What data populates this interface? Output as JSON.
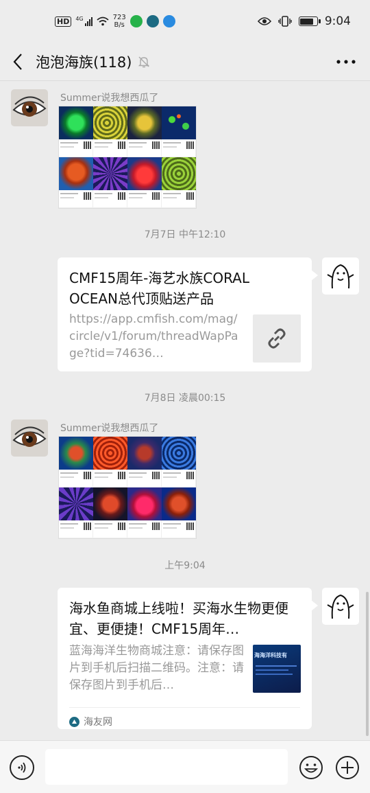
{
  "status_bar": {
    "hd": "HD",
    "net_type": "4G",
    "speed_value": "723",
    "speed_unit": "B/s",
    "time": "9:04",
    "battery_level": 0.8
  },
  "header": {
    "title": "泡泡海族(118)"
  },
  "messages": {
    "m1_sender": "Summer说我想西瓜了",
    "t1": "7月7日 中午12:10",
    "link_title": "CMF15周年-海艺水族CORAL OCEAN总代顶贴送产品",
    "link_url": "https://app.cmfish.com/mag/circle/v1/forum/threadWapPage?tid=74636…",
    "t2": "7月8日 凌晨00:15",
    "m2_sender": "Summer说我想西瓜了",
    "t3": "上午9:04",
    "article_title": "海水鱼商城上线啦！买海水生物更便宜、更便捷！CMF15周年…",
    "article_desc": "蓝海海洋生物商城注意：请保存图片到手机后扫描二维码。注意：请保存图片到手机后…",
    "article_thumb_text": "海海洋科技有",
    "article_source": "海友网"
  },
  "colors": {
    "chat_bg": "#ececec",
    "bubble": "#ffffff",
    "meta_text": "#8a8a8a",
    "source_icon": "#1d6b83"
  },
  "icons": {
    "back": "chevron-left-icon",
    "mute": "bell-off-icon",
    "more": "more-dots-icon",
    "link": "link-icon",
    "voice": "voice-icon",
    "emoji": "emoji-icon",
    "plus": "plus-icon"
  }
}
